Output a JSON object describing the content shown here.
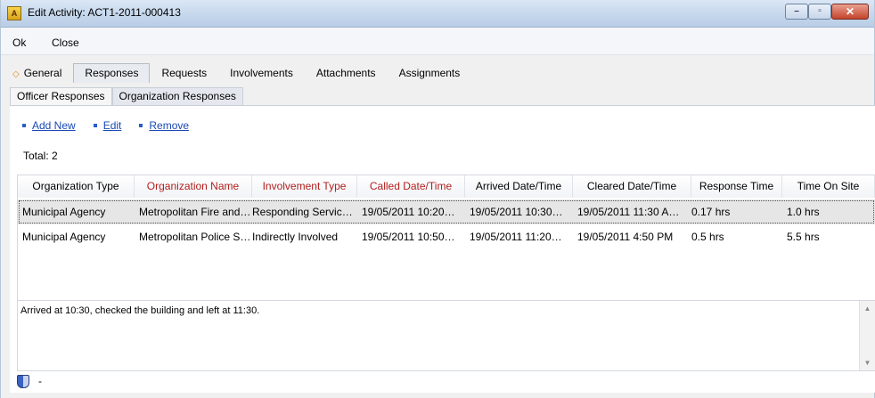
{
  "window": {
    "title": "Edit Activity: ACT1-2011-000413",
    "app_icon_text": "A",
    "minimize_glyph": "–",
    "maximize_glyph": "▫",
    "close_glyph": "✕"
  },
  "menu": {
    "ok": "Ok",
    "close": "Close"
  },
  "tabs": [
    {
      "label": "General",
      "icon": "diamond-icon"
    },
    {
      "label": "Responses"
    },
    {
      "label": "Requests"
    },
    {
      "label": "Involvements"
    },
    {
      "label": "Attachments"
    },
    {
      "label": "Assignments"
    }
  ],
  "subtabs": [
    "Officer Responses",
    "Organization Responses"
  ],
  "actions": {
    "add_new": "Add New",
    "edit": "Edit",
    "remove": "Remove"
  },
  "total": "Total: 2",
  "columns": [
    "Organization Type",
    "Organization Name",
    "Involvement Type",
    "Called Date/Time",
    "Arrived Date/Time",
    "Cleared Date/Time",
    "Response Time",
    "Time On Site"
  ],
  "rows": [
    [
      "Municipal Agency",
      "Metropolitan Fire and…",
      "Responding Servic…",
      "19/05/2011   10:20…",
      "19/05/2011   10:30…",
      "19/05/2011   11:30 A…",
      "0.17 hrs",
      "1.0 hrs"
    ],
    [
      "Municipal Agency",
      "Metropolitan Police S…",
      "Indirectly Involved",
      "19/05/2011   10:50…",
      "19/05/2011   11:20…",
      "19/05/2011   4:50 PM",
      "0.5 hrs",
      "5.5 hrs"
    ]
  ],
  "notes": "Arrived at 10:30, checked the building and left at 11:30.",
  "status_text": "-",
  "colors": {
    "header_red": "#b0201f",
    "link_blue": "#1a49b5"
  }
}
